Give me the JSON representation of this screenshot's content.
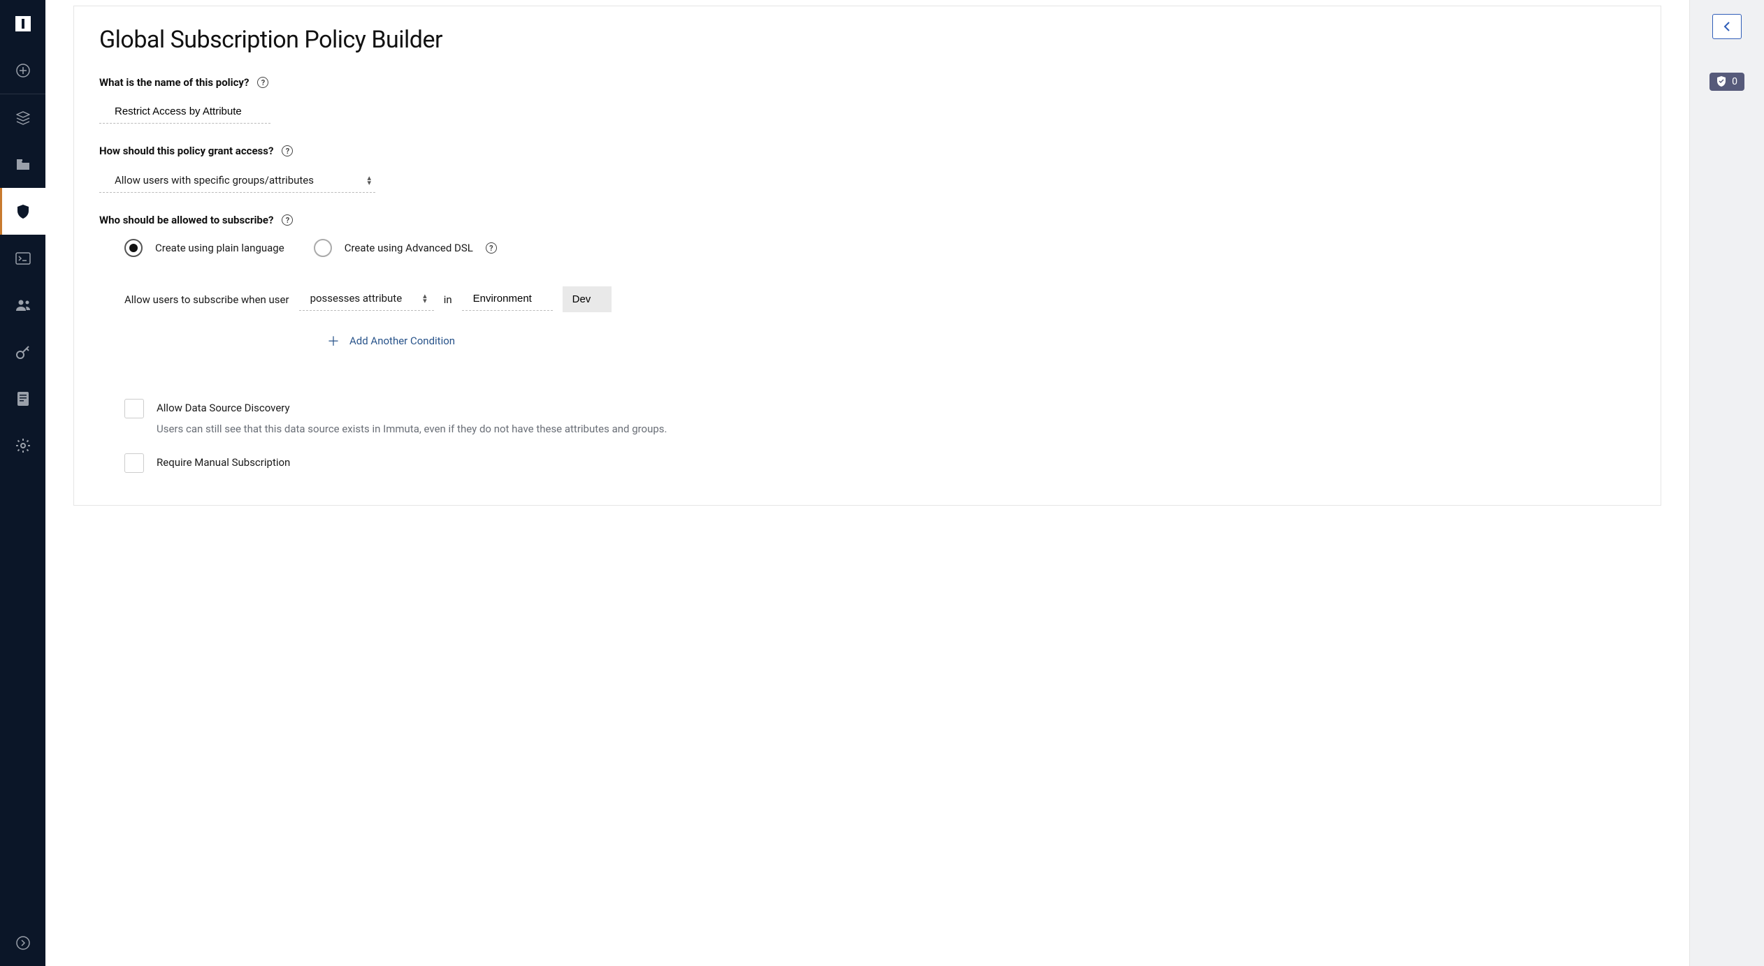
{
  "page_title": "Global Subscription Policy Builder",
  "q_name": {
    "label": "What is the name of this policy?",
    "value": "Restrict Access by Attribute"
  },
  "q_access": {
    "label": "How should this policy grant access?",
    "selected": "Allow users with specific groups/attributes"
  },
  "q_subscribe": {
    "label": "Who should be allowed to subscribe?",
    "options": {
      "plain": "Create using plain language",
      "dsl": "Create using Advanced DSL",
      "selected": "plain"
    }
  },
  "rule": {
    "prefix": "Allow users to subscribe when user",
    "operator": "possesses attribute",
    "joiner": "in",
    "key": "Environment",
    "value": "Dev"
  },
  "add_condition_label": "Add Another Condition",
  "opt_discovery": {
    "label": "Allow Data Source Discovery",
    "helper": "Users can still see that this data source exists in Immuta, even if they do not have these attributes and groups."
  },
  "opt_manual": {
    "label": "Require Manual Subscription"
  },
  "right_rail": {
    "badge_count": "0"
  },
  "sidebar": {
    "items": [
      "logo",
      "plus",
      "layers",
      "folder",
      "shield",
      "terminal",
      "users",
      "key",
      "document",
      "gear",
      "collapse"
    ],
    "active": "shield"
  }
}
